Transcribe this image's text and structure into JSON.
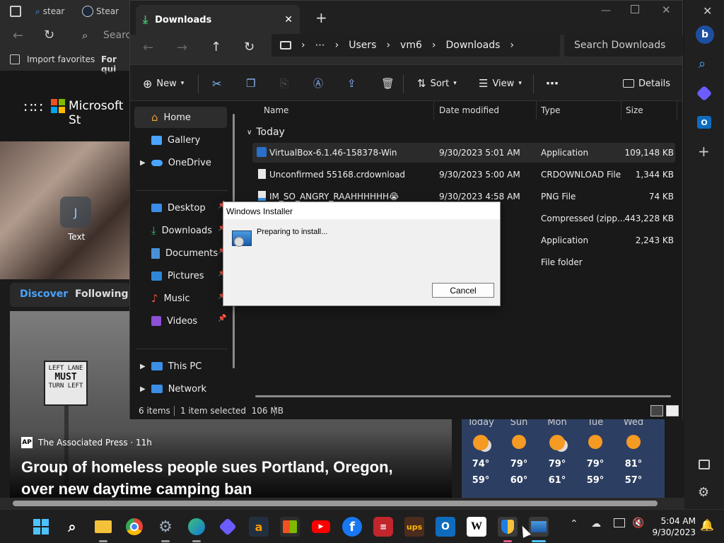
{
  "edge": {
    "tabs": [
      "stear",
      "Stear"
    ],
    "search_placeholder": "Search",
    "favorites": [
      "Import favorites",
      "For qui"
    ],
    "brand": "Microsoft St",
    "shortcut_label": "Text",
    "feed_tabs": [
      "Discover",
      "Following"
    ],
    "news_source": "The Associated Press · 11h",
    "news_source_logo": "AP",
    "headline_line1": "Group of homeless people sues Portland, Oregon,",
    "headline_line2": "over new daytime camping ban",
    "sign_lines": [
      "LEFT LANE",
      "MUST",
      "TURN LEFT"
    ],
    "weather": [
      {
        "day": "Today",
        "hi": "74°",
        "lo": "59°"
      },
      {
        "day": "Sun",
        "hi": "79°",
        "lo": "60°"
      },
      {
        "day": "Mon",
        "hi": "79°",
        "lo": "61°"
      },
      {
        "day": "Tue",
        "hi": "79°",
        "lo": "59°"
      },
      {
        "day": "Wed",
        "hi": "81°",
        "lo": "57°"
      }
    ]
  },
  "explorer": {
    "tab_title": "Downloads",
    "breadcrumb": [
      "Users",
      "vm6",
      "Downloads"
    ],
    "search_placeholder": "Search Downloads",
    "toolbar": {
      "new": "New",
      "sort": "Sort",
      "view": "View",
      "details": "Details"
    },
    "nav": [
      {
        "label": "Home",
        "icon": "home-icon",
        "selected": true
      },
      {
        "label": "Gallery",
        "icon": "gallery-icon"
      },
      {
        "label": "OneDrive",
        "icon": "cloud-icon"
      },
      {
        "label": "Desktop",
        "icon": "desktop-icon"
      },
      {
        "label": "Downloads",
        "icon": "download-icon"
      },
      {
        "label": "Documents",
        "icon": "document-icon"
      },
      {
        "label": "Pictures",
        "icon": "picture-icon"
      },
      {
        "label": "Music",
        "icon": "music-icon"
      },
      {
        "label": "Videos",
        "icon": "video-icon"
      },
      {
        "label": "This PC",
        "icon": "pc-icon"
      },
      {
        "label": "Network",
        "icon": "network-icon"
      }
    ],
    "columns": [
      "Name",
      "Date modified",
      "Type",
      "Size"
    ],
    "group": "Today",
    "files": [
      {
        "name": "VirtualBox-6.1.46-158378-Win",
        "date": "9/30/2023 5:01 AM",
        "type": "Application",
        "size": "109,148 KB"
      },
      {
        "name": "Unconfirmed 55168.crdownload",
        "date": "9/30/2023 5:00 AM",
        "type": "CRDOWNLOAD File",
        "size": "1,344 KB"
      },
      {
        "name": "IM_SO_ANGRY_RAAHHHHHH😭",
        "date": "9/30/2023 4:58 AM",
        "type": "PNG File",
        "size": "74 KB"
      },
      {
        "name": "",
        "date": "M",
        "type": "Compressed (zipp...",
        "size": "443,228 KB"
      },
      {
        "name": "",
        "date": "M",
        "type": "Application",
        "size": "2,243 KB"
      },
      {
        "name": "",
        "date": "M",
        "type": "File folder",
        "size": ""
      }
    ],
    "status": {
      "items": "6 items",
      "selected": "1 item selected  106 MB"
    }
  },
  "installer": {
    "title": "Windows Installer",
    "message": "Preparing to install...",
    "cancel": "Cancel"
  },
  "taskbar": {
    "time": "5:04 AM",
    "date": "9/30/2023"
  }
}
